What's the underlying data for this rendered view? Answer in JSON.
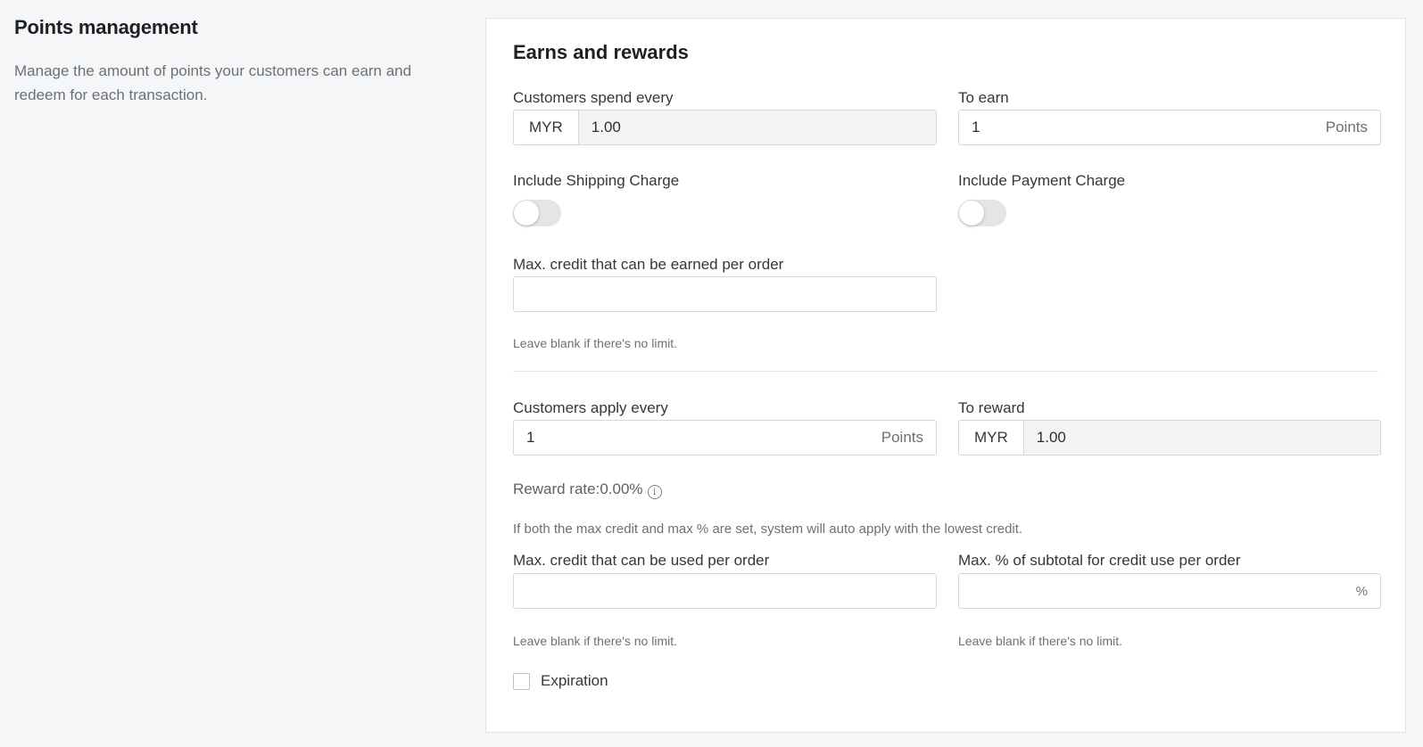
{
  "sidebar": {
    "title": "Points management",
    "description": "Manage the amount of points your customers can earn and redeem for each transaction."
  },
  "card": {
    "title": "Earns and rewards",
    "spend_label": "Customers spend every",
    "spend_currency": "MYR",
    "spend_value": "1.00",
    "earn_label": "To earn",
    "earn_value": "1",
    "earn_unit": "Points",
    "shipping_label": "Include Shipping Charge",
    "payment_label": "Include Payment Charge",
    "max_earn_label": "Max. credit that can be earned per order",
    "max_earn_value": "",
    "max_earn_hint": "Leave blank if there's no limit.",
    "apply_label": "Customers apply every",
    "apply_value": "1",
    "apply_unit": "Points",
    "reward_label": "To reward",
    "reward_currency": "MYR",
    "reward_value": "1.00",
    "reward_rate": "Reward rate:0.00%",
    "auto_apply_note": "If both the max credit and max % are set, system will auto apply with the lowest credit.",
    "max_use_label": "Max. credit that can be used per order",
    "max_use_value": "",
    "max_use_hint": "Leave blank if there's no limit.",
    "max_pct_label": "Max. % of subtotal for credit use per order",
    "max_pct_value": "",
    "max_pct_unit": "%",
    "max_pct_hint": "Leave blank if there's no limit.",
    "expiration_label": "Expiration"
  },
  "states": {
    "include_shipping": false,
    "include_payment": false,
    "expiration_checked": false
  },
  "icons": {
    "info": "info-circle-icon"
  }
}
